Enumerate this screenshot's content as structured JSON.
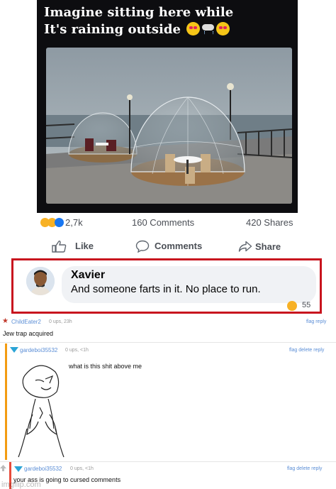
{
  "post": {
    "caption_line1": "Imagine sitting here while",
    "caption_line2": "It's raining outside",
    "reaction_count": "2,7k",
    "comments_count": "160 Comments",
    "shares_count": "420 Shares",
    "like_label": "Like",
    "comment_label": "Comments",
    "share_label": "Share"
  },
  "highlight_comment": {
    "author": "Xavier",
    "text": "And someone farts in it. No place to run.",
    "reactions": "55"
  },
  "comments": [
    {
      "username": "ChildEater2",
      "meta": "0 ups, 23h",
      "links": "flag reply",
      "text": "Jew trap acquired"
    },
    {
      "username": "gardeboi35532",
      "meta": "0 ups, <1h",
      "links": "flag delete reply",
      "text": "what is this shit above me"
    },
    {
      "username": "gardeboi35532",
      "meta": "0 ups, <1h",
      "links": "flag delete reply",
      "text": "your ass is going to cursed comments"
    }
  ],
  "watermark": "imgflip.com",
  "colors": {
    "highlight_border": "#c8141e",
    "fb_blue": "#1877f2",
    "imgflip_link": "#5b8ed6"
  }
}
